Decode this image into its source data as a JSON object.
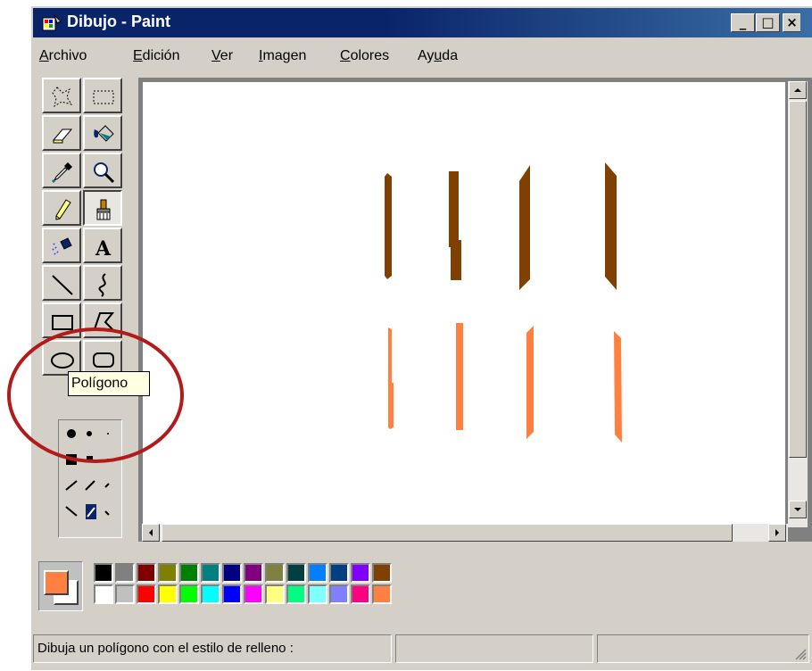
{
  "window": {
    "title": "Dibujo - Paint",
    "icon": "paint-app-icon"
  },
  "title_buttons": {
    "minimize": "_",
    "maximize": "□",
    "close": "×"
  },
  "menu": [
    {
      "label": "Archivo",
      "access": "A",
      "rest": "rchivo"
    },
    {
      "label": "Edición",
      "access": "E",
      "rest": "dición"
    },
    {
      "label": "Ver",
      "access": "V",
      "rest": "er"
    },
    {
      "label": "Imagen",
      "access": "I",
      "rest": "magen"
    },
    {
      "label": "Colores",
      "access": "C",
      "rest": "olores"
    },
    {
      "label": "Ayuda",
      "pre": "Ay",
      "access": "u",
      "rest": "da"
    }
  ],
  "tools": [
    "free-form-select",
    "select",
    "eraser",
    "fill-with-color",
    "pick-color",
    "magnifier",
    "pencil",
    "brush",
    "airbrush",
    "text",
    "line",
    "curve",
    "rectangle",
    "polygon",
    "ellipse",
    "rounded-rectangle"
  ],
  "selected_tool": "brush",
  "tooltip": "Polígono",
  "annotation_color": "#b31b1b",
  "colors": {
    "foreground": "#ff8040",
    "background": "#ffffff",
    "brown": "#804000",
    "orange": "#ff8040",
    "palette_top": [
      "#000000",
      "#808080",
      "#800000",
      "#808000",
      "#008000",
      "#008080",
      "#000080",
      "#800080",
      "#808040",
      "#004040",
      "#0080ff",
      "#004080",
      "#8000ff",
      "#804000"
    ],
    "palette_bottom": [
      "#ffffff",
      "#c0c0c0",
      "#ff0000",
      "#ffff00",
      "#00ff00",
      "#00ffff",
      "#0000ff",
      "#ff00ff",
      "#ffff80",
      "#00ff80",
      "#80ffff",
      "#8080ff",
      "#ff0080",
      "#ff8040"
    ]
  },
  "status": {
    "text": "Dibuja un polígono con el estilo de relleno :"
  }
}
